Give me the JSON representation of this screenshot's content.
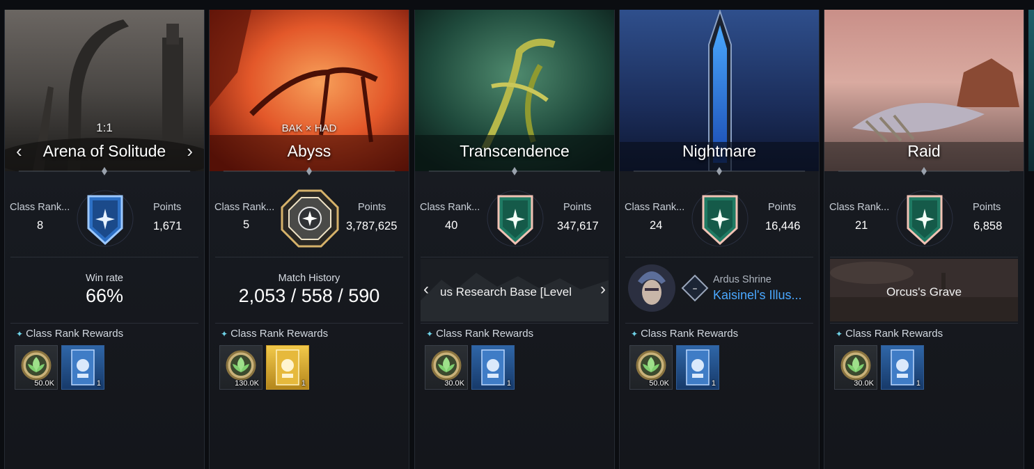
{
  "cards": [
    {
      "name": "Arena of Solitude",
      "subtitle": "1:1",
      "has_arrows": true,
      "class_rank_label": "Class Rank...",
      "class_rank_value": "8",
      "points_label": "Points",
      "points_value": "1,671",
      "emblem": "blue-star-shield-icon",
      "mid_label": "Win rate",
      "mid_value": "66%",
      "rewards_title": "Class Rank Rewards",
      "rewards": [
        {
          "icon": "leaf-coin-icon",
          "qty": "50.0K"
        },
        {
          "icon": "blue-ticket-icon",
          "qty": "1"
        }
      ]
    },
    {
      "name": "Abyss",
      "subtitle": "BAK × HAD",
      "class_rank_label": "Class Rank...",
      "class_rank_value": "5",
      "points_label": "Points",
      "points_value": "3,787,625",
      "emblem": "gold-octagon-icon",
      "mid_label": "Match History",
      "mid_value": "2,053 / 558 / 590",
      "rewards_title": "Class Rank Rewards",
      "rewards": [
        {
          "icon": "leaf-coin-icon",
          "qty": "130.0K"
        },
        {
          "icon": "gold-ticket-icon",
          "qty": "1"
        }
      ]
    },
    {
      "name": "Transcendence",
      "class_rank_label": "Class Rank...",
      "class_rank_value": "40",
      "points_label": "Points",
      "points_value": "347,617",
      "emblem": "green-star-shield-icon",
      "map_label": "us Research Base [Level",
      "rewards_title": "Class Rank Rewards",
      "rewards": [
        {
          "icon": "leaf-coin-icon",
          "qty": "30.0K"
        },
        {
          "icon": "blue-ticket-icon",
          "qty": "1"
        }
      ]
    },
    {
      "name": "Nightmare",
      "class_rank_label": "Class Rank...",
      "class_rank_value": "24",
      "points_label": "Points",
      "points_value": "16,446",
      "emblem": "green-star-shield-icon",
      "boss_location": "Ardus Shrine",
      "boss_name": "Kaisinel's Illus...",
      "boss_badge": "–",
      "rewards_title": "Class Rank Rewards",
      "rewards": [
        {
          "icon": "leaf-coin-icon",
          "qty": "50.0K"
        },
        {
          "icon": "blue-ticket-icon",
          "qty": "1"
        }
      ]
    },
    {
      "name": "Raid",
      "class_rank_label": "Class Rank...",
      "class_rank_value": "21",
      "points_label": "Points",
      "points_value": "6,858",
      "emblem": "green-star-shield-icon",
      "map_label": "Orcus's Grave",
      "rewards_title": "Class Rank Rewards",
      "rewards": [
        {
          "icon": "leaf-coin-icon",
          "qty": "30.0K"
        },
        {
          "icon": "blue-ticket-icon",
          "qty": "1"
        }
      ]
    }
  ],
  "arrows": {
    "left": "‹",
    "right": "›"
  },
  "colors": {
    "accent_cyan": "#6fd3e8",
    "boss_name_blue": "#4aa8ff",
    "emblem_green": "#1f7a63",
    "emblem_blue": "#2c6fc4",
    "emblem_gold": "#d6b26a"
  }
}
